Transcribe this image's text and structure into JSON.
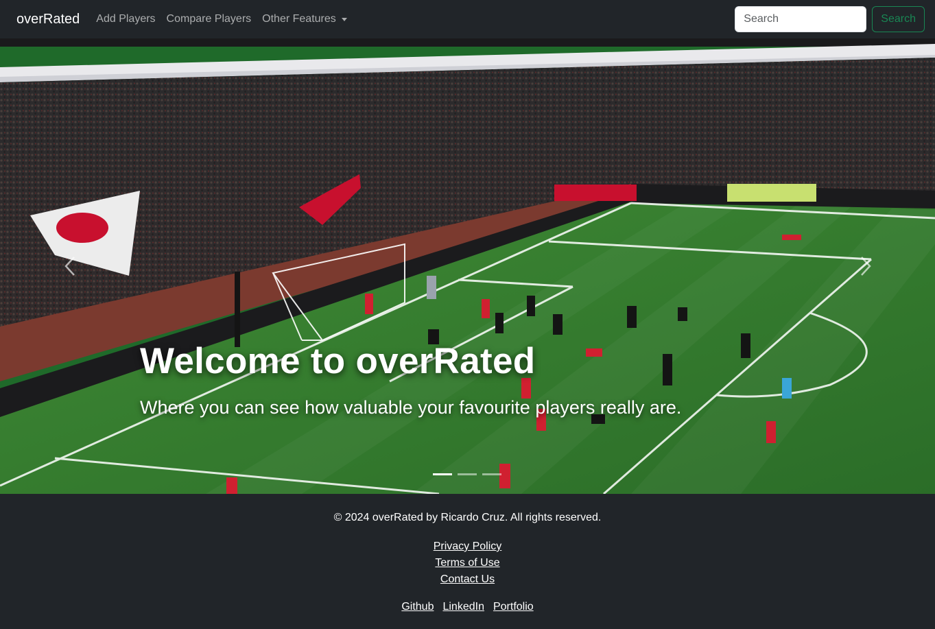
{
  "navbar": {
    "brand": "overRated",
    "links": [
      {
        "label": "Add Players"
      },
      {
        "label": "Compare Players"
      },
      {
        "label": "Other Features"
      }
    ],
    "search": {
      "placeholder": "Search",
      "button_label": "Search"
    }
  },
  "hero": {
    "title": "Welcome to overRated",
    "subtitle": "Where you can see how valuable your favourite players really are.",
    "slide_count": 3,
    "active_slide": 1
  },
  "footer": {
    "copyright": "© 2024 overRated by Ricardo Cruz. All rights reserved.",
    "legal_links": [
      "Privacy Policy",
      "Terms of Use",
      "Contact Us"
    ],
    "social_links": [
      "Github",
      "LinkedIn",
      "Portfolio"
    ]
  },
  "colors": {
    "navbar_bg": "#212529",
    "accent_green": "#198754",
    "pitch_green": "#2f7a2e"
  }
}
